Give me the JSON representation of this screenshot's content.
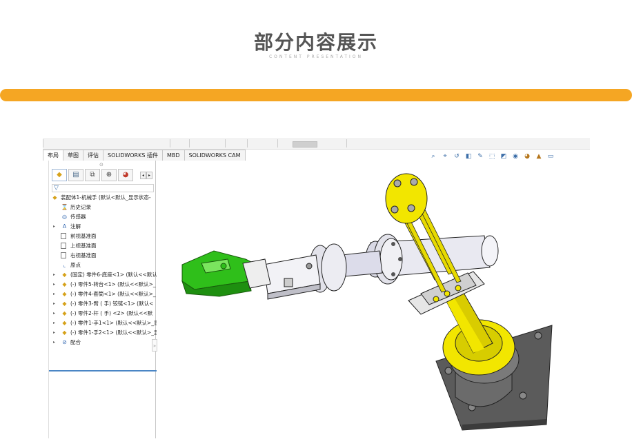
{
  "header": {
    "title": "部分内容展示",
    "subtitle": "CONTENT PRESENTATION"
  },
  "colors": {
    "accent": "#f5a623",
    "part_yellow": "#f2e600",
    "gripper_green": "#2fbf1a",
    "base_gray": "#6e6e6e"
  },
  "app": {
    "tabs": [
      {
        "label": "布局"
      },
      {
        "label": "草图"
      },
      {
        "label": "评估"
      },
      {
        "label": "SOLIDWORKS 插件"
      },
      {
        "label": "MBD"
      },
      {
        "label": "SOLIDWORKS CAM"
      }
    ],
    "view_icons": [
      "zoom-fit-icon",
      "zoom-area-icon",
      "previous-view-icon",
      "section-view-icon",
      "dynamic-annotation-icon",
      "view-orientation-icon",
      "display-style-icon",
      "hide-show-icon",
      "edit-appearance-icon",
      "apply-scene-icon",
      "view-settings-icon"
    ],
    "panel_tabs": [
      "feature-manager-icon",
      "property-manager-icon",
      "configuration-manager-icon",
      "dimxpert-icon",
      "display-manager-icon"
    ],
    "tree": [
      {
        "label": "装配体1-机械手 (默认<默认_显示状态-",
        "icon": "assembly-icon",
        "indent": 0,
        "expander": ""
      },
      {
        "label": "历史记录",
        "icon": "history-icon",
        "indent": 1,
        "expander": ""
      },
      {
        "label": "传感器",
        "icon": "sensor-icon",
        "indent": 1,
        "expander": ""
      },
      {
        "label": "注解",
        "icon": "annotation-icon",
        "indent": 1,
        "expander": "▸"
      },
      {
        "label": "前视基准面",
        "icon": "plane-icon",
        "indent": 1,
        "expander": ""
      },
      {
        "label": "上视基准面",
        "icon": "plane-icon",
        "indent": 1,
        "expander": ""
      },
      {
        "label": "右视基准面",
        "icon": "plane-icon",
        "indent": 1,
        "expander": ""
      },
      {
        "label": "原点",
        "icon": "origin-icon",
        "indent": 1,
        "expander": ""
      },
      {
        "label": "(固定) 零件6-底座<1> (默认<<默认",
        "icon": "part-icon",
        "indent": 1,
        "expander": "▸"
      },
      {
        "label": "(-) 零件5-转台<1> (默认<<默认>_",
        "icon": "part-icon",
        "indent": 1,
        "expander": "▸"
      },
      {
        "label": "(-) 零件4-套筒<1> (默认<<默认>_",
        "icon": "part-icon",
        "indent": 1,
        "expander": "▸"
      },
      {
        "label": "(-) 零件3-臂 ( 手) 铰链<1> (默认<",
        "icon": "part-icon",
        "indent": 1,
        "expander": "▸"
      },
      {
        "label": "(-) 零件2-杆 ( 手) <2> (默认<<默",
        "icon": "part-icon",
        "indent": 1,
        "expander": "▸"
      },
      {
        "label": "(-) 零件1-手1<1> (默认<<默认>_显",
        "icon": "part-icon",
        "indent": 1,
        "expander": "▸"
      },
      {
        "label": "(-) 零件1-手2<1> (默认<<默认>_显",
        "icon": "part-icon",
        "indent": 1,
        "expander": "▸"
      },
      {
        "label": "配合",
        "icon": "mates-icon",
        "indent": 1,
        "expander": "▸"
      }
    ]
  }
}
